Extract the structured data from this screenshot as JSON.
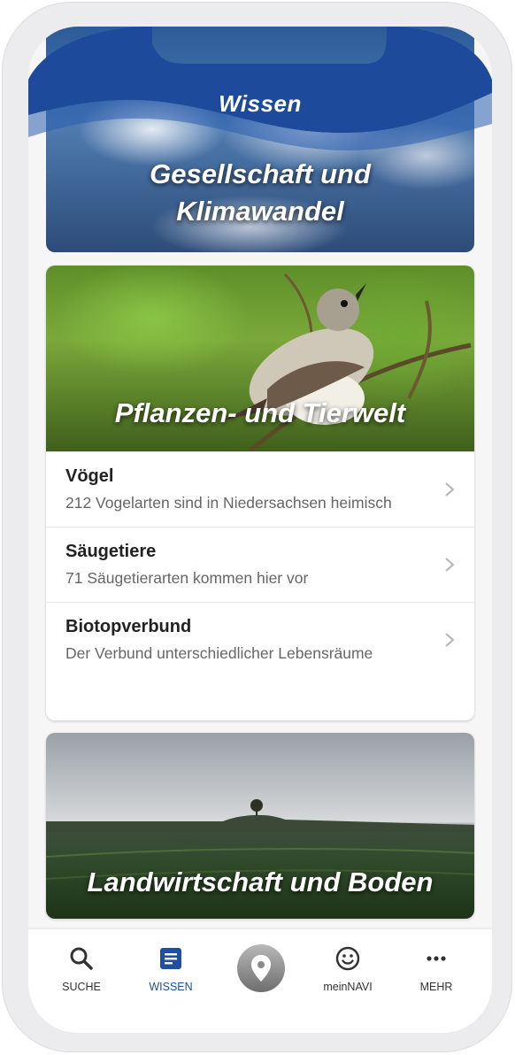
{
  "header": {
    "title": "Wissen",
    "card_title_line1": "Gesellschaft und",
    "card_title_line2": "Klimawandel"
  },
  "sections": [
    {
      "title": "Pflanzen- und Tierwelt",
      "items": [
        {
          "title": "Vögel",
          "subtitle": "212 Vogelarten sind in Niedersachsen heimisch"
        },
        {
          "title": "Säugetiere",
          "subtitle": "71 Säugetierarten kommen hier vor"
        },
        {
          "title": "Biotopverbund",
          "subtitle": "Der Verbund unterschiedlicher Lebensräume"
        }
      ]
    },
    {
      "title": "Landwirtschaft und Boden"
    }
  ],
  "nav": {
    "items": [
      {
        "label": "SUCHE",
        "icon": "search-icon"
      },
      {
        "label": "WISSEN",
        "icon": "document-icon",
        "active": true
      },
      {
        "label": "",
        "icon": "map-pin-icon"
      },
      {
        "label": "meinNAVI",
        "icon": "smiley-icon"
      },
      {
        "label": "MEHR",
        "icon": "more-icon"
      }
    ]
  },
  "colors": {
    "brand_blue": "#1e4fa0",
    "header_blue": "#1d4a9b",
    "text_dark": "#222222",
    "text_muted": "#666666"
  }
}
